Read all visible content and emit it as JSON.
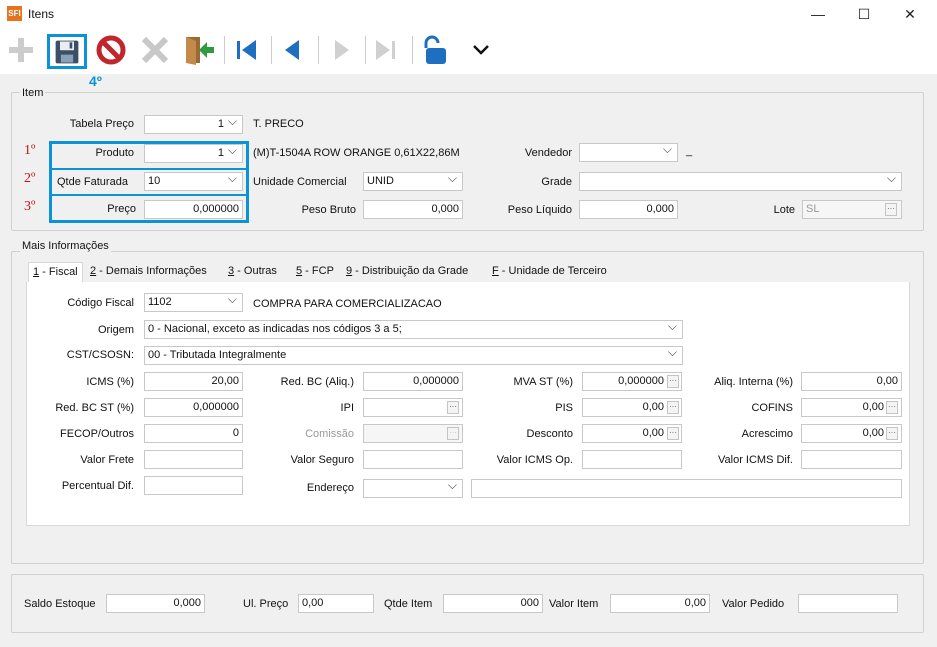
{
  "window": {
    "logo": "SFI",
    "title": "Itens",
    "minimize": "—",
    "maximize": "☐",
    "close": "✕"
  },
  "toolbar": {
    "step_label": "4º"
  },
  "item": {
    "legend": "Item",
    "tabela_preco": {
      "label": "Tabela Preço",
      "value": "1",
      "desc": "T. PRECO"
    },
    "produto": {
      "label": "Produto",
      "value": "1",
      "desc": "(M)T-1504A ROW ORANGE 0,61X22,86M"
    },
    "qtde": {
      "label": "Qtde Faturada",
      "value": "10"
    },
    "preco": {
      "label": "Preço",
      "value": "0,000000"
    },
    "vendedor": {
      "label": "Vendedor",
      "value": "",
      "desc": "_"
    },
    "unidade": {
      "label": "Unidade Comercial",
      "value": "UNID"
    },
    "grade": {
      "label": "Grade",
      "value": ""
    },
    "peso_bruto": {
      "label": "Peso Bruto",
      "value": "0,000"
    },
    "peso_liquido": {
      "label": "Peso Líquido",
      "value": "0,000"
    },
    "lote": {
      "label": "Lote",
      "value": "SL"
    },
    "steps": [
      "1º",
      "2º",
      "3º"
    ]
  },
  "mais": {
    "legend": "Mais Informações",
    "tabs": [
      {
        "key": "1",
        "label": " - Fiscal"
      },
      {
        "key": "2",
        "label": " - Demais Informações"
      },
      {
        "key": "3",
        "label": " - Outras"
      },
      {
        "key": "5",
        "label": " - FCP"
      },
      {
        "key": "9",
        "label": " - Distribuição da Grade"
      },
      {
        "key": "F",
        "label": " - Unidade de Terceiro"
      }
    ],
    "codigo_fiscal": {
      "label": "Código Fiscal",
      "value": "1102",
      "desc": "COMPRA PARA COMERCIALIZACAO"
    },
    "origem": {
      "label": "Origem",
      "value": "0 - Nacional, exceto as indicadas nos códigos 3 a 5;"
    },
    "cst": {
      "label": "CST/CSOSN:",
      "value": "00 - Tributada Integralmente"
    },
    "icms": {
      "label": "ICMS (%)",
      "value": "20,00"
    },
    "red_bc_aliq": {
      "label": "Red. BC (Aliq.)",
      "value": "0,000000"
    },
    "mva_st": {
      "label": "MVA ST (%)",
      "value": "0,000000"
    },
    "aliq_interna": {
      "label": "Aliq. Interna (%)",
      "value": "0,00"
    },
    "red_bc_st": {
      "label": "Red. BC ST (%)",
      "value": "0,000000"
    },
    "ipi": {
      "label": "IPI",
      "value": ""
    },
    "pis": {
      "label": "PIS",
      "value": "0,00"
    },
    "cofins": {
      "label": "COFINS",
      "value": "0,00"
    },
    "fecop": {
      "label": "FECOP/Outros",
      "value": "0"
    },
    "comissao": {
      "label": "Comissão",
      "value": ""
    },
    "desconto": {
      "label": "Desconto",
      "value": "0,00"
    },
    "acrescimo": {
      "label": "Acrescimo",
      "value": "0,00"
    },
    "valor_frete": {
      "label": "Valor Frete",
      "value": ""
    },
    "valor_seguro": {
      "label": "Valor Seguro",
      "value": ""
    },
    "valor_icms_op": {
      "label": "Valor ICMS Op.",
      "value": ""
    },
    "valor_icms_dif": {
      "label": "Valor ICMS Dif.",
      "value": ""
    },
    "percentual_dif": {
      "label": "Percentual Dif.",
      "value": ""
    },
    "endereco": {
      "label": "Endereço",
      "value": "",
      "desc": ""
    }
  },
  "footer": {
    "saldo": {
      "label": "Saldo Estoque",
      "value": "0,000"
    },
    "ul_preco": {
      "label": "Ul. Preço",
      "value": "0,00"
    },
    "qtde_item": {
      "label": "Qtde Item",
      "value": "000"
    },
    "valor_item": {
      "label": "Valor Item",
      "value": "0,00"
    },
    "valor_pedido": {
      "label": "Valor Pedido",
      "value": ""
    }
  },
  "ellipsis": "···",
  "colors": {
    "highlight": "#0a93d6",
    "annotation": "#c01818",
    "accent": "#1f6fc0"
  }
}
